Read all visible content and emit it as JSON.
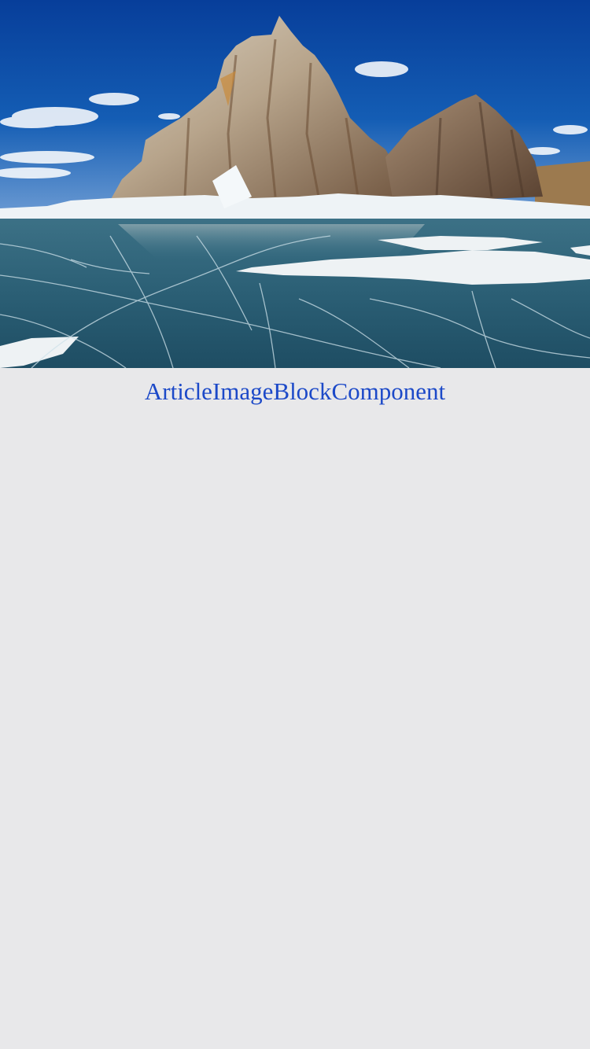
{
  "article": {
    "caption": "ArticleImageBlockComponent"
  },
  "colors": {
    "page_background": "#e8e8ea",
    "caption_text": "#1c49c8"
  },
  "image": {
    "subject": "ice-lake-rock-island-photo"
  }
}
